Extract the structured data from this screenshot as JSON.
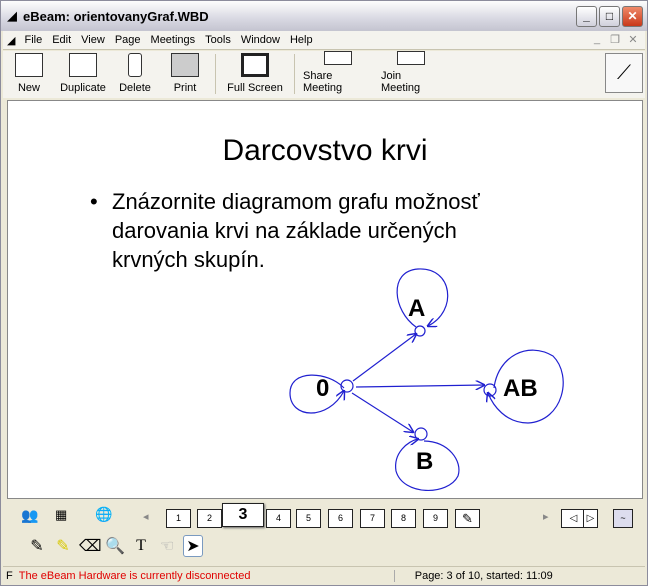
{
  "window": {
    "title": "eBeam: orientovanyGraf.WBD"
  },
  "menu": [
    "File",
    "Edit",
    "View",
    "Page",
    "Meetings",
    "Tools",
    "Window",
    "Help"
  ],
  "toolbar": [
    {
      "label": "New",
      "icon": "new-page-icon"
    },
    {
      "label": "Duplicate",
      "icon": "duplicate-icon"
    },
    {
      "label": "Delete",
      "icon": "trash-icon"
    },
    {
      "label": "Print",
      "icon": "printer-icon"
    },
    {
      "label": "Full Screen",
      "icon": "monitor-icon"
    },
    {
      "label": "Share Meeting",
      "icon": "share-meeting-icon"
    },
    {
      "label": "Join Meeting",
      "icon": "join-meeting-icon"
    }
  ],
  "slide": {
    "title": "Darcovstvo krvi",
    "bullet": "•",
    "lines": [
      "Znázornite diagramom grafu možnosť",
      "darovania krvi na základe určených",
      "krvných skupín."
    ],
    "graph": {
      "nodes": [
        "0",
        "A",
        "AB",
        "B"
      ],
      "edge_color": "#2020d0"
    }
  },
  "pages": {
    "items": [
      "1",
      "2",
      "3",
      "4",
      "5",
      "6",
      "7",
      "8",
      "9"
    ],
    "current": "3"
  },
  "status": {
    "left": "F",
    "message": "The eBeam Hardware is currently disconnected",
    "page_info": "Page: 3 of 10, started: 11:09",
    "message_color": "#e00000"
  }
}
